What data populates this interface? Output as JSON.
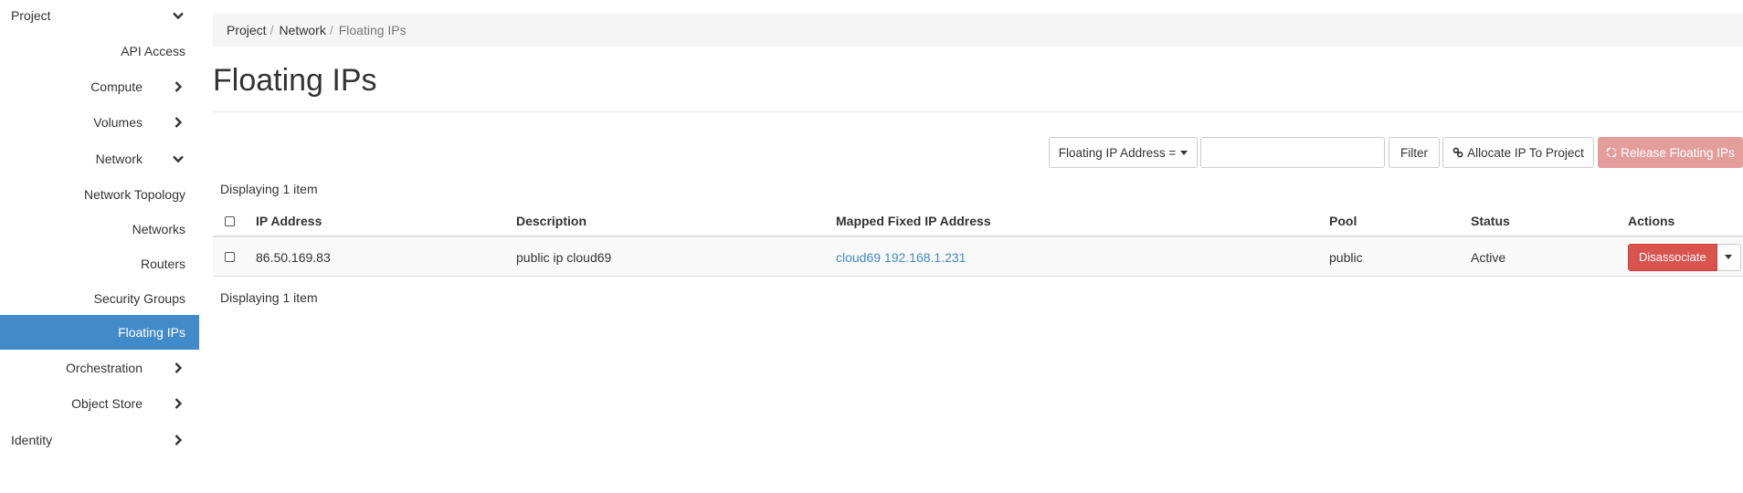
{
  "sidebar": {
    "project": "Project",
    "api_access": "API Access",
    "compute": "Compute",
    "volumes": "Volumes",
    "network": "Network",
    "network_topology": "Network Topology",
    "networks": "Networks",
    "routers": "Routers",
    "security_groups": "Security Groups",
    "floating_ips": "Floating IPs",
    "orchestration": "Orchestration",
    "object_store": "Object Store",
    "identity": "Identity"
  },
  "breadcrumb": {
    "project": "Project",
    "network": "Network",
    "current": "Floating IPs",
    "separator": "/"
  },
  "page": {
    "title": "Floating IPs"
  },
  "toolbar": {
    "filter_field": "Floating IP Address =",
    "filter_value": "",
    "filter_button": "Filter",
    "allocate_button": "Allocate IP To Project",
    "release_button": "Release Floating IPs"
  },
  "table": {
    "count_top": "Displaying 1 item",
    "count_bottom": "Displaying 1 item",
    "columns": {
      "ip": "IP Address",
      "description": "Description",
      "mapped": "Mapped Fixed IP Address",
      "pool": "Pool",
      "status": "Status",
      "actions": "Actions"
    },
    "rows": [
      {
        "ip": "86.50.169.83",
        "description": "public ip cloud69",
        "mapped": "cloud69 192.168.1.231",
        "pool": "public",
        "status": "Active",
        "action": "Disassociate"
      }
    ]
  },
  "colors": {
    "active_nav": "#428bca",
    "link": "#428bca",
    "danger": "#d9534f",
    "danger_disabled": "#e39e9c"
  }
}
